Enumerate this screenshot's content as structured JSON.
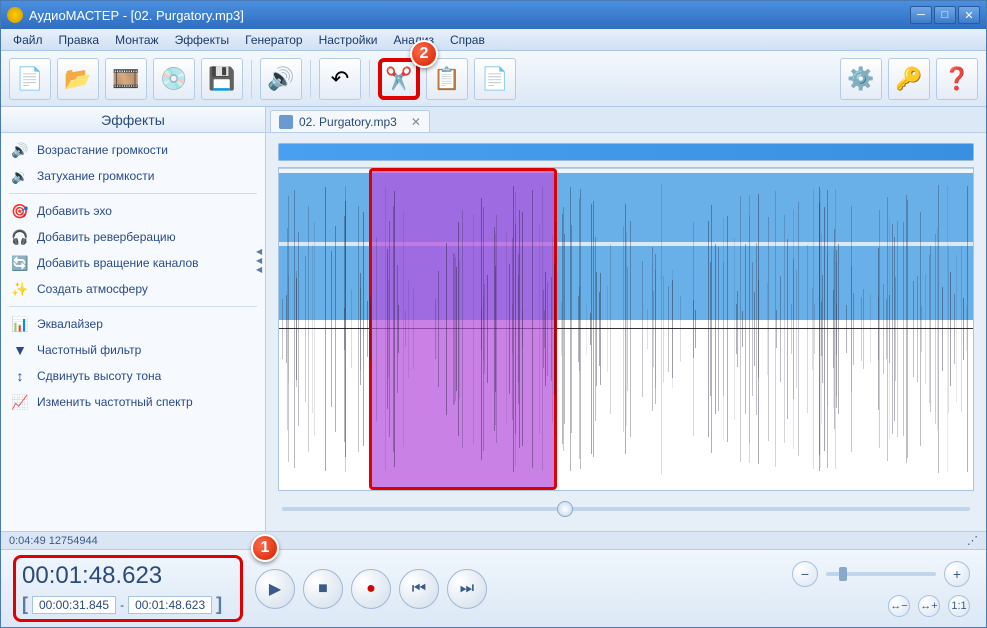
{
  "title": "АудиоМАСТЕР - [02. Purgatory.mp3]",
  "menu": [
    "Файл",
    "Правка",
    "Монтаж",
    "Эффекты",
    "Генератор",
    "Настройки",
    "Анализ",
    "Справ"
  ],
  "sidebar_title": "Эффекты",
  "effects": [
    {
      "icon": "🔊",
      "label": "Возрастание громкости"
    },
    {
      "icon": "🔉",
      "label": "Затухание громкости"
    },
    {
      "icon": "🎯",
      "label": "Добавить эхо"
    },
    {
      "icon": "🎧",
      "label": "Добавить реверберацию"
    },
    {
      "icon": "🔄",
      "label": "Добавить вращение каналов"
    },
    {
      "icon": "✨",
      "label": "Создать атмосферу"
    },
    {
      "icon": "📊",
      "label": "Эквалайзер"
    },
    {
      "icon": "▼",
      "label": "Частотный фильтр"
    },
    {
      "icon": "↕",
      "label": "Сдвинуть высоту тона"
    },
    {
      "icon": "📈",
      "label": "Изменить частотный спектр"
    }
  ],
  "tab": {
    "label": "02. Purgatory.mp3"
  },
  "status": "0:04:49 12754944",
  "time": {
    "current": "00:01:48.623",
    "start": "00:00:31.845",
    "end": "00:01:48.623"
  },
  "annotations": {
    "a1": "1",
    "a2": "2"
  }
}
